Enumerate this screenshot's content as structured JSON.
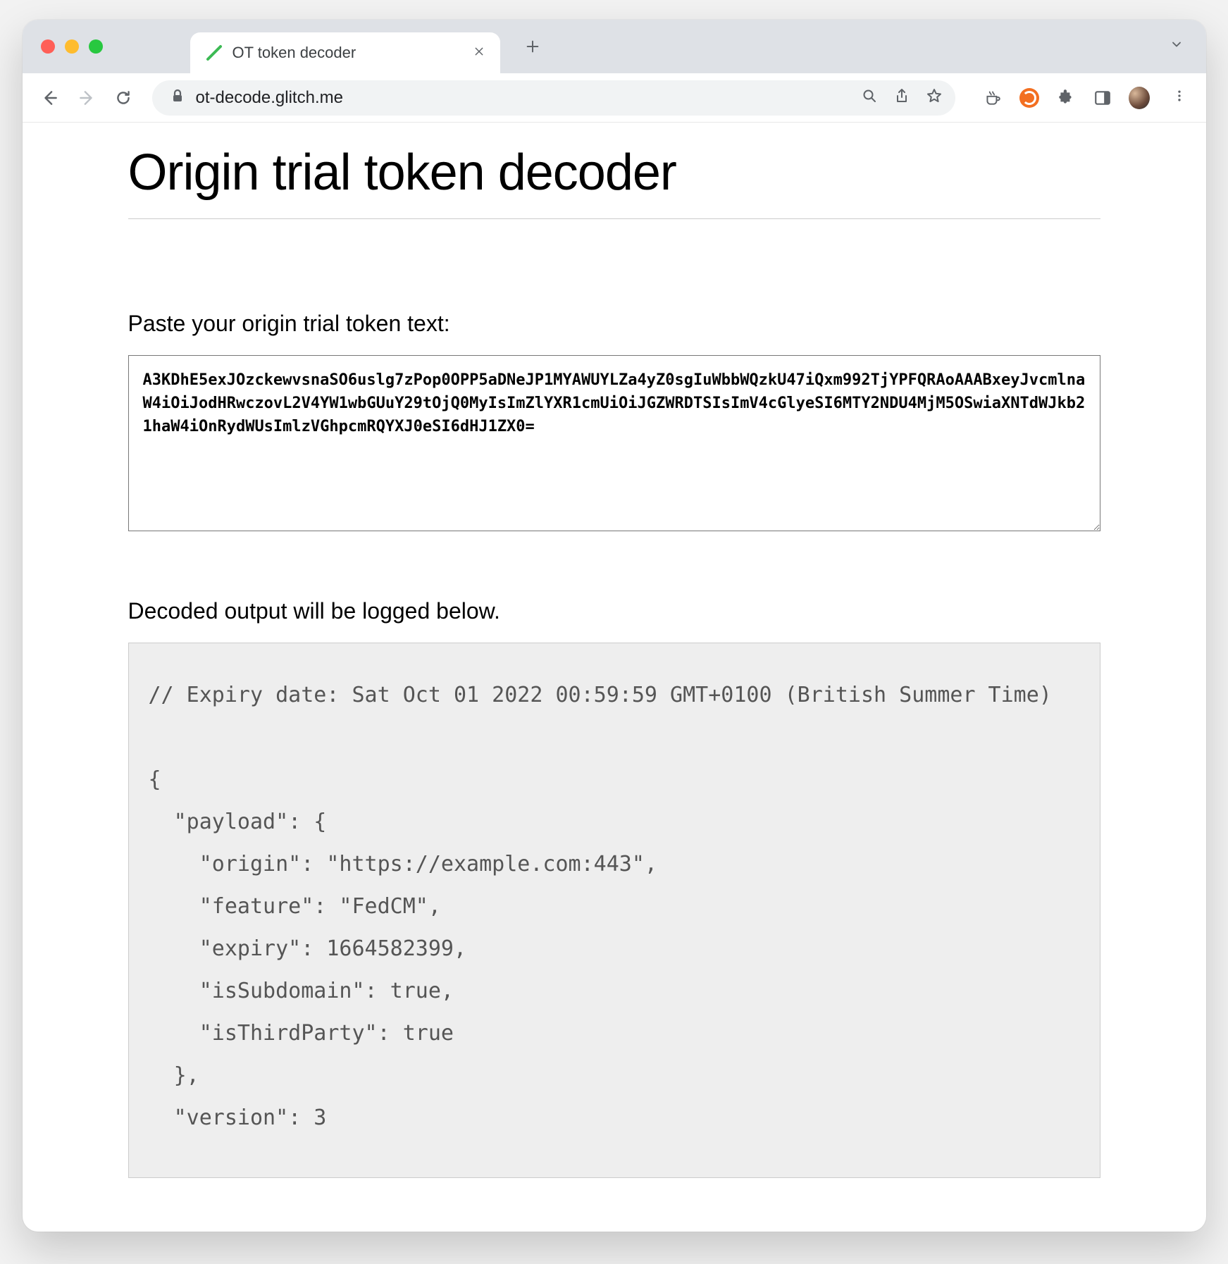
{
  "browser": {
    "tab": {
      "title": "OT token decoder"
    },
    "url": "ot-decode.glitch.me"
  },
  "page": {
    "title": "Origin trial token decoder",
    "inputLabel": "Paste your origin trial token text:",
    "tokenValue": "A3KDhE5exJOzckewvsnaSO6uslg7zPop0OPP5aDNeJP1MYAWUYLZa4yZ0sgIuWbbWQzkU47iQxm992TjYPFQRAoAAABxeyJvcmlnaW4iOiJodHRwczovL2V4YW1wbGUuY29tOjQ0MyIsImZlYXR1cmUiOiJGZWRDTSIsImV4cGlyeSI6MTY2NDU4MjM5OSwiaXNTdWJkb21haW4iOnRydWUsImlzVGhpcmRQYXJ0eSI6dHJ1ZX0=",
    "outputLabel": "Decoded output will be logged below.",
    "decodedOutput": "// Expiry date: Sat Oct 01 2022 00:59:59 GMT+0100 (British Summer Time)\n\n{\n  \"payload\": {\n    \"origin\": \"https://example.com:443\",\n    \"feature\": \"FedCM\",\n    \"expiry\": 1664582399,\n    \"isSubdomain\": true,\n    \"isThirdParty\": true\n  },\n  \"version\": 3"
  }
}
